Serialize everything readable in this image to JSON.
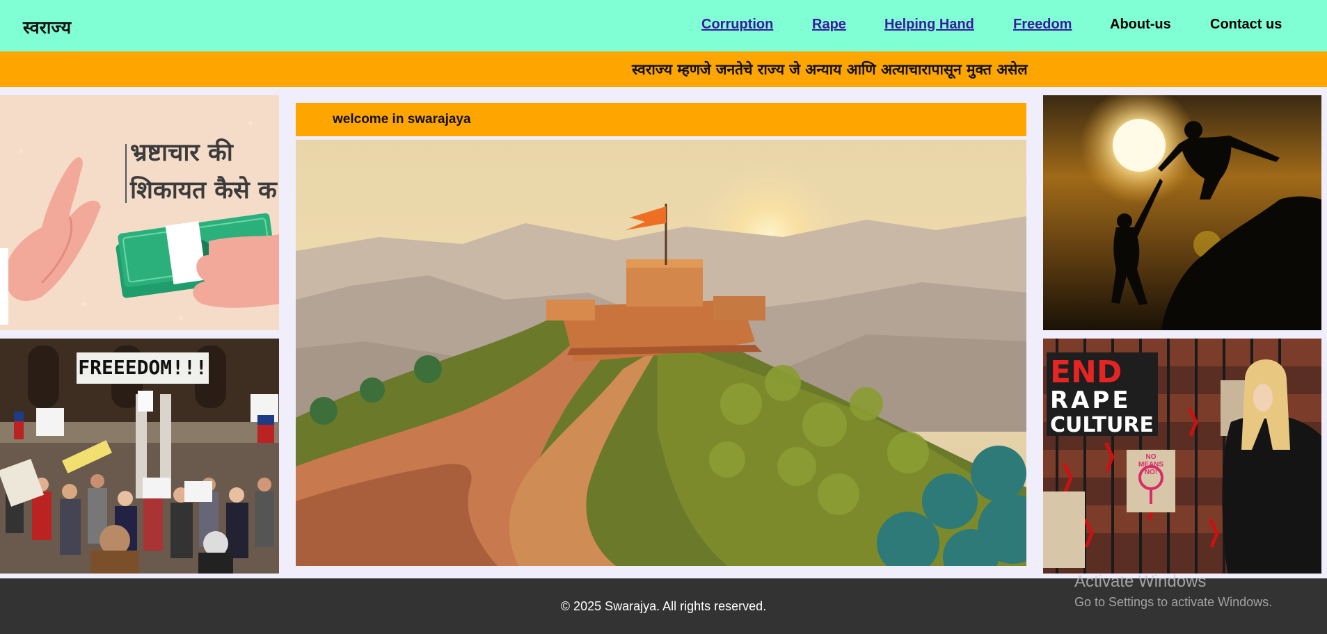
{
  "navbar": {
    "brand": "स्वराज्य",
    "links": [
      "Corruption",
      "Rape",
      "Helping Hand",
      "Freedom",
      "About-us",
      "Contact us"
    ]
  },
  "ticker": {
    "text": "स्वराज्य म्हणजे जनतेचे राज्य जे अन्याय आणि अत्याचारापासून मुक्त असेल"
  },
  "left_panels": {
    "corruption_text": [
      "भ्रष्टाचार की",
      "शिकायत कैसे क"
    ],
    "freedom_sign": "FREEEDOM!!!"
  },
  "center": {
    "welcome": "welcome in swarajaya"
  },
  "right_panels": {
    "rape_sign": [
      "END",
      "RAPE",
      "CULTURE"
    ],
    "small_sign": [
      "NO",
      "MEANS",
      "NO!"
    ]
  },
  "footer": {
    "text": "© 2025 Swarajya. All rights reserved."
  },
  "overlay": {
    "title": "Activate Windows",
    "subtitle": "Go to Settings to activate Windows."
  },
  "colors": {
    "nav_bg": "#80ffd4",
    "accent": "#ffa500",
    "page_bg": "#f0eefb",
    "footer_bg": "#333333",
    "link": "#3b1b9e"
  }
}
